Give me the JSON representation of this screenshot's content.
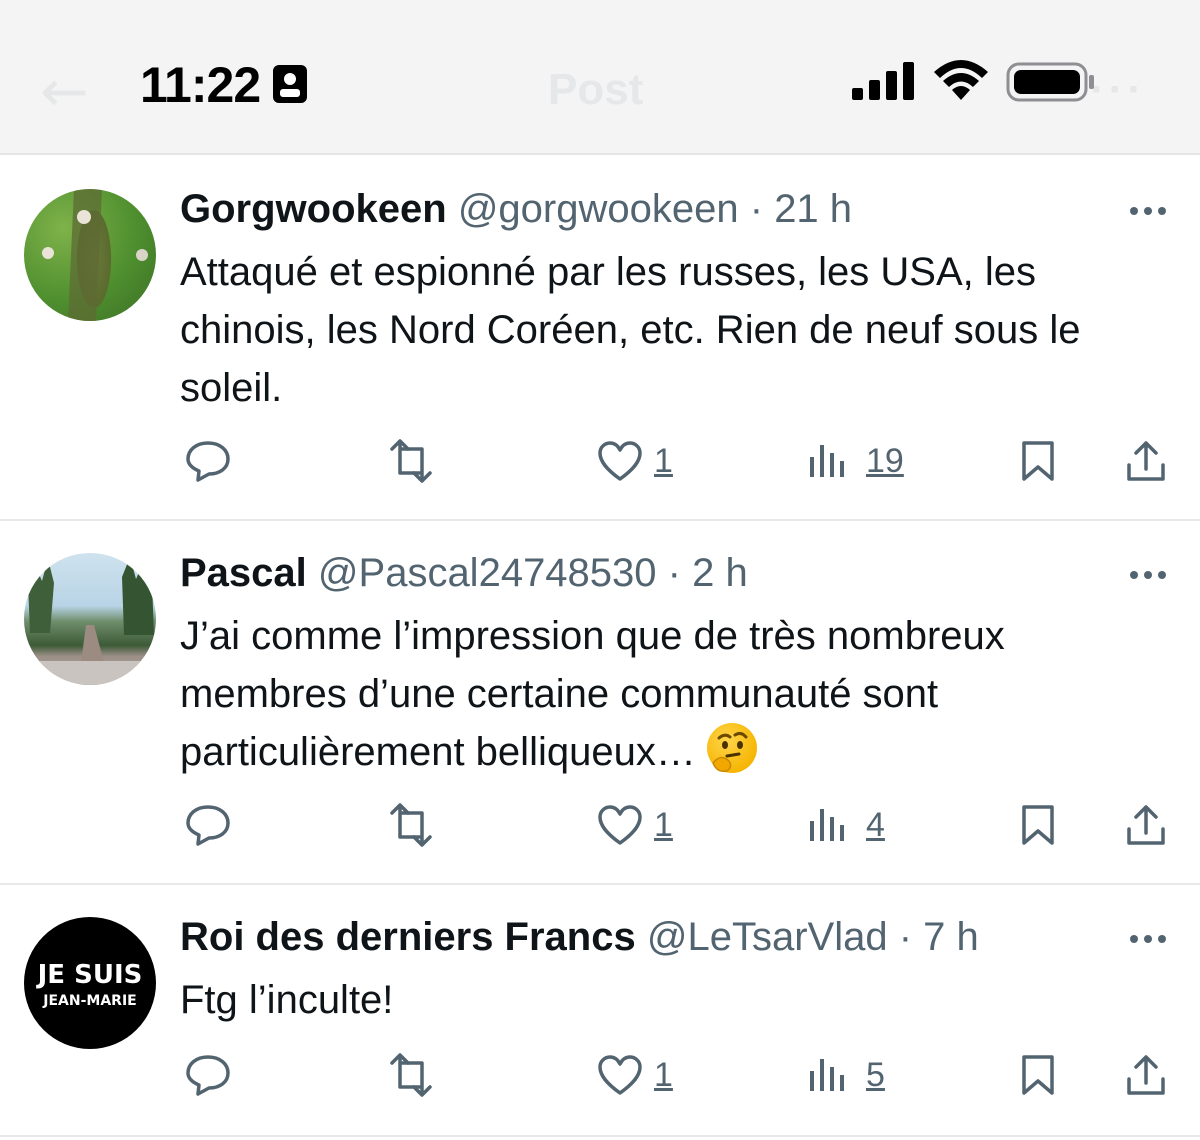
{
  "status_bar": {
    "time": "11:22",
    "nav_title": "Post"
  },
  "tweets": [
    {
      "name": "Gorgwookeen",
      "handle": "@gorgwookeen",
      "time": "21 h",
      "avatar": "green-field-avatar",
      "lines": [
        "Attaqué et espionné par les russes, les USA, les",
        "chinois, les Nord Coréen, etc. Rien de neuf sous le",
        "soleil."
      ],
      "likes": "1",
      "views": "19"
    },
    {
      "name": "Pascal",
      "handle": "@Pascal24748530",
      "time": "2 h",
      "avatar": "beach-path-avatar",
      "lines": [
        "J’ai comme l’impression que de très nombreux",
        "membres d’une certaine communauté sont",
        "particulièrement belliqueux…"
      ],
      "likes": "1",
      "views": "4"
    },
    {
      "name": "Roi des derniers Francs",
      "handle": "@LeTsarVlad",
      "time": "7 h",
      "avatar": "je-suis-jean-marie-avatar",
      "avatar_text": [
        "JE SUIS",
        "JEAN-MARIE"
      ],
      "lines": [
        "Ftg l’inculte!"
      ],
      "likes": "1",
      "views": "5"
    }
  ],
  "separator": "·",
  "colors": {
    "text": "#0f1419",
    "secondary": "#536471",
    "divider": "#e7e9ea"
  }
}
